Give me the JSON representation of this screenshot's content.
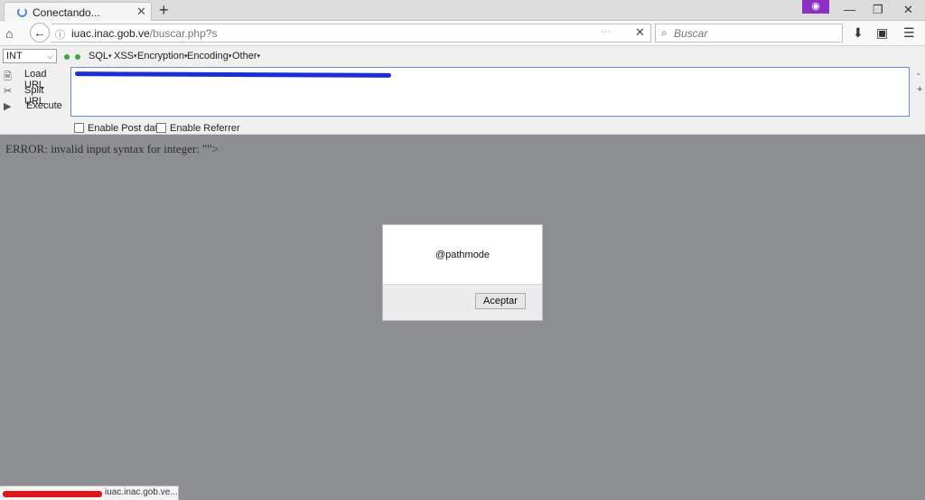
{
  "browser": {
    "tab_title": "Conectando...",
    "tab_close": "✕",
    "new_tab": "+",
    "private_icon": "mask-icon",
    "url_host": "iuac.inac.gob.ve",
    "url_path": "/buscar.php?s",
    "search_placeholder": "Buscar",
    "window_minimize": "—",
    "window_restore": "❐",
    "window_close": "✕"
  },
  "hackbar": {
    "select_value": "INT",
    "menus": [
      "SQL",
      "XSS",
      "Encryption",
      "Encoding",
      "Other"
    ],
    "actions": [
      {
        "label": "Load URL",
        "icon": "load-url-icon"
      },
      {
        "label": "Split URL",
        "icon": "split-url-icon"
      },
      {
        "label": "Execute",
        "icon": "execute-icon"
      }
    ],
    "side_minus": "-",
    "side_plus": "+",
    "enable_post": "Enable Post data",
    "enable_referrer": "Enable Referrer",
    "scribble_color": "#1a2ed6"
  },
  "page": {
    "error_text": "ERROR: invalid input syntax for integer: \"\">"
  },
  "dialog": {
    "message": "@pathmode",
    "ok_label": "Aceptar"
  },
  "status": {
    "host": "iuac.inac.gob.ve...",
    "scribble_color": "#e0151a"
  }
}
